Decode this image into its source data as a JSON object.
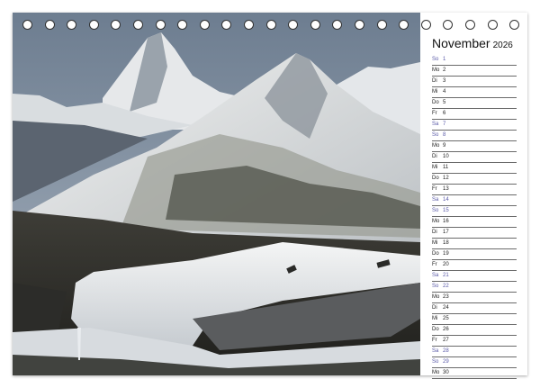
{
  "calendar": {
    "month": "November",
    "year": "2026",
    "days": [
      {
        "dn": "So",
        "num": "1",
        "weekend": true
      },
      {
        "dn": "Mo",
        "num": "2",
        "weekend": false
      },
      {
        "dn": "Di",
        "num": "3",
        "weekend": false
      },
      {
        "dn": "Mi",
        "num": "4",
        "weekend": false
      },
      {
        "dn": "Do",
        "num": "5",
        "weekend": false
      },
      {
        "dn": "Fr",
        "num": "6",
        "weekend": false
      },
      {
        "dn": "Sa",
        "num": "7",
        "weekend": true
      },
      {
        "dn": "So",
        "num": "8",
        "weekend": true
      },
      {
        "dn": "Mo",
        "num": "9",
        "weekend": false
      },
      {
        "dn": "Di",
        "num": "10",
        "weekend": false
      },
      {
        "dn": "Mi",
        "num": "11",
        "weekend": false
      },
      {
        "dn": "Do",
        "num": "12",
        "weekend": false
      },
      {
        "dn": "Fr",
        "num": "13",
        "weekend": false
      },
      {
        "dn": "Sa",
        "num": "14",
        "weekend": true
      },
      {
        "dn": "So",
        "num": "15",
        "weekend": true
      },
      {
        "dn": "Mo",
        "num": "16",
        "weekend": false
      },
      {
        "dn": "Di",
        "num": "17",
        "weekend": false
      },
      {
        "dn": "Mi",
        "num": "18",
        "weekend": false
      },
      {
        "dn": "Do",
        "num": "19",
        "weekend": false
      },
      {
        "dn": "Fr",
        "num": "20",
        "weekend": false
      },
      {
        "dn": "Sa",
        "num": "21",
        "weekend": true
      },
      {
        "dn": "So",
        "num": "22",
        "weekend": true
      },
      {
        "dn": "Mo",
        "num": "23",
        "weekend": false
      },
      {
        "dn": "Di",
        "num": "24",
        "weekend": false
      },
      {
        "dn": "Mi",
        "num": "25",
        "weekend": false
      },
      {
        "dn": "Do",
        "num": "26",
        "weekend": false
      },
      {
        "dn": "Fr",
        "num": "27",
        "weekend": false
      },
      {
        "dn": "Sa",
        "num": "28",
        "weekend": true
      },
      {
        "dn": "So",
        "num": "29",
        "weekend": true
      },
      {
        "dn": "Mo",
        "num": "30",
        "weekend": false
      }
    ]
  },
  "colors": {
    "weekend": "#5a5aa8",
    "weekday": "#222222"
  }
}
